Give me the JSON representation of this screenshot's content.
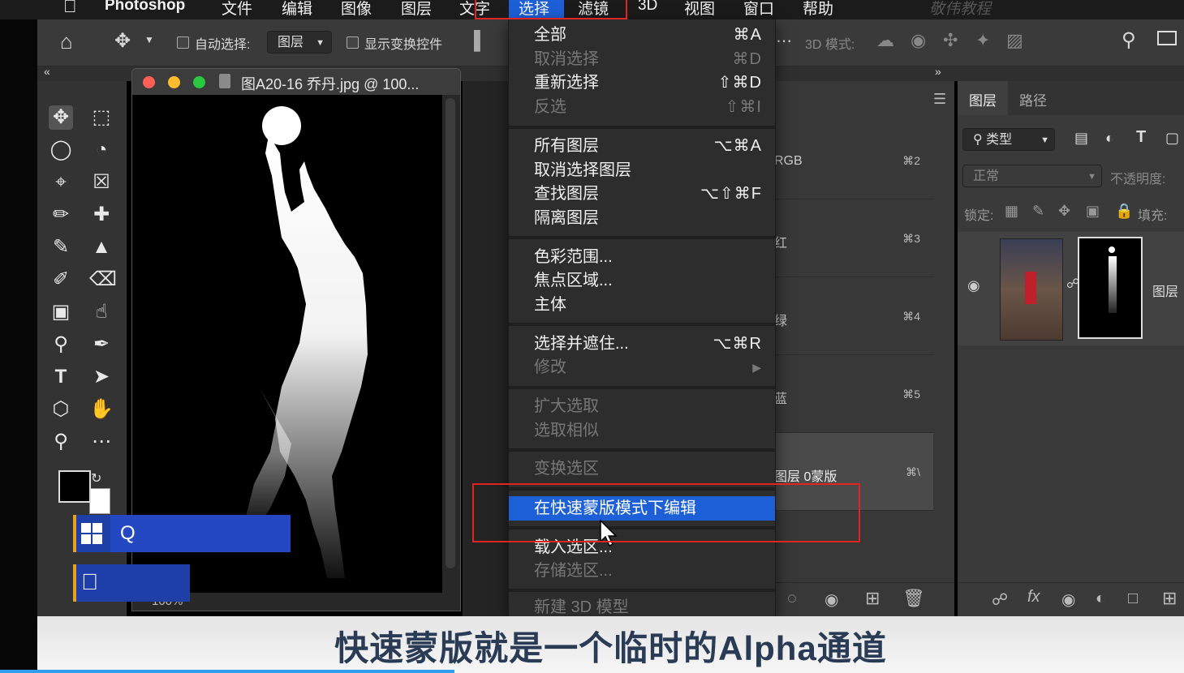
{
  "menubar": {
    "app_name": "Photoshop",
    "items": [
      "文件",
      "编辑",
      "图像",
      "图层",
      "文字",
      "选择",
      "滤镜",
      "3D",
      "视图",
      "窗口",
      "帮助"
    ],
    "active_item": "选择",
    "watermark": "敬伟教程"
  },
  "options_bar": {
    "auto_select_label": "自动选择:",
    "auto_select_value": "图层",
    "show_transform_label": "显示变换控件",
    "mode_3d_label": "3D 模式:"
  },
  "document": {
    "title": "图A20-16 乔丹.jpg @ 100...",
    "zoom": "100%"
  },
  "dropdown_menu": {
    "items": [
      {
        "label": "全部",
        "shortcut": "⌘A",
        "enabled": true
      },
      {
        "label": "取消选择",
        "shortcut": "⌘D",
        "enabled": false
      },
      {
        "label": "重新选择",
        "shortcut": "⇧⌘D",
        "enabled": true
      },
      {
        "label": "反选",
        "shortcut": "⇧⌘I",
        "enabled": false
      },
      {
        "label": "所有图层",
        "shortcut": "⌥⌘A",
        "enabled": true
      },
      {
        "label": "取消选择图层",
        "shortcut": "",
        "enabled": true
      },
      {
        "label": "查找图层",
        "shortcut": "⌥⇧⌘F",
        "enabled": true
      },
      {
        "label": "隔离图层",
        "shortcut": "",
        "enabled": true
      },
      {
        "label": "色彩范围...",
        "shortcut": "",
        "enabled": true
      },
      {
        "label": "焦点区域...",
        "shortcut": "",
        "enabled": true
      },
      {
        "label": "主体",
        "shortcut": "",
        "enabled": true
      },
      {
        "label": "选择并遮住...",
        "shortcut": "⌥⌘R",
        "enabled": true
      },
      {
        "label": "修改",
        "shortcut": "▶",
        "enabled": false
      },
      {
        "label": "扩大选取",
        "shortcut": "",
        "enabled": false
      },
      {
        "label": "选取相似",
        "shortcut": "",
        "enabled": false
      },
      {
        "label": "变换选区",
        "shortcut": "",
        "enabled": false
      },
      {
        "label": "在快速蒙版模式下编辑",
        "shortcut": "",
        "enabled": true,
        "highlighted": true
      },
      {
        "label": "载入选区...",
        "shortcut": "",
        "enabled": true
      },
      {
        "label": "存储选区...",
        "shortcut": "",
        "enabled": false
      },
      {
        "label": "新建 3D 模型",
        "shortcut": "",
        "enabled": false
      }
    ]
  },
  "channels_panel": {
    "rows": [
      {
        "name": "RGB",
        "shortcut": "⌘2"
      },
      {
        "name": "红",
        "shortcut": "⌘3"
      },
      {
        "name": "绿",
        "shortcut": "⌘4"
      },
      {
        "name": "蓝",
        "shortcut": "⌘5"
      },
      {
        "name": "图层 0蒙版",
        "shortcut": "⌘\\"
      }
    ]
  },
  "layers_panel": {
    "tabs": [
      "图层",
      "路径"
    ],
    "active_tab": "图层",
    "filter_label": "类型",
    "blend_mode": "正常",
    "opacity_label": "不透明度:",
    "lock_label": "锁定:",
    "fill_label": "填充:",
    "layer_name": "图层"
  },
  "taskbar": {
    "search_text": "Q"
  },
  "subtitle": "快速蒙版就是一个临时的Alpha通道",
  "colors": {
    "highlight": "#1c5fd6",
    "annotation_red": "#e02424",
    "subtitle_text": "#2a3b55"
  }
}
